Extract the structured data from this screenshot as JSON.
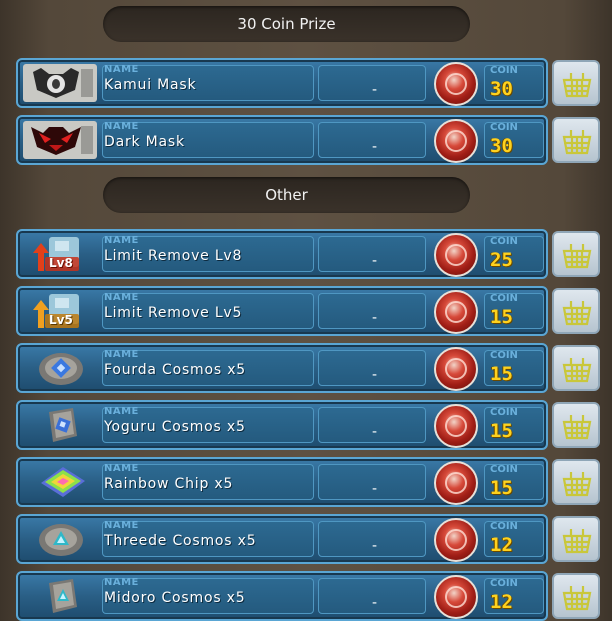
{
  "sections": {
    "coin30": {
      "label": "30 Coin Prize"
    },
    "other": {
      "label": "Other"
    }
  },
  "labels": {
    "name_tag": "NAME",
    "coin_tag": "COIN",
    "dash": "-"
  },
  "items": [
    {
      "icon": "kamui-mask-icon",
      "name": "Kamui Mask",
      "cost": "30"
    },
    {
      "icon": "dark-mask-icon",
      "name": "Dark Mask",
      "cost": "30"
    },
    {
      "icon": "limit-remove-lv8-icon",
      "name": "Limit Remove Lv8",
      "cost": "25",
      "badge": "Lv8"
    },
    {
      "icon": "limit-remove-lv5-icon",
      "name": "Limit Remove Lv5",
      "cost": "15",
      "badge": "Lv5"
    },
    {
      "icon": "fourda-cosmos-icon",
      "name": "Fourda Cosmos x5",
      "cost": "15"
    },
    {
      "icon": "yoguru-cosmos-icon",
      "name": "Yoguru Cosmos x5",
      "cost": "15"
    },
    {
      "icon": "rainbow-chip-icon",
      "name": "Rainbow Chip x5",
      "cost": "15"
    },
    {
      "icon": "threede-cosmos-icon",
      "name": "Threede Cosmos x5",
      "cost": "12"
    },
    {
      "icon": "midoro-cosmos-icon",
      "name": "Midoro Cosmos x5",
      "cost": "12"
    }
  ],
  "colors": {
    "panel": "#2a5f86",
    "coin_text": "#ffd21e",
    "accent_label": "#6ab0dc"
  }
}
